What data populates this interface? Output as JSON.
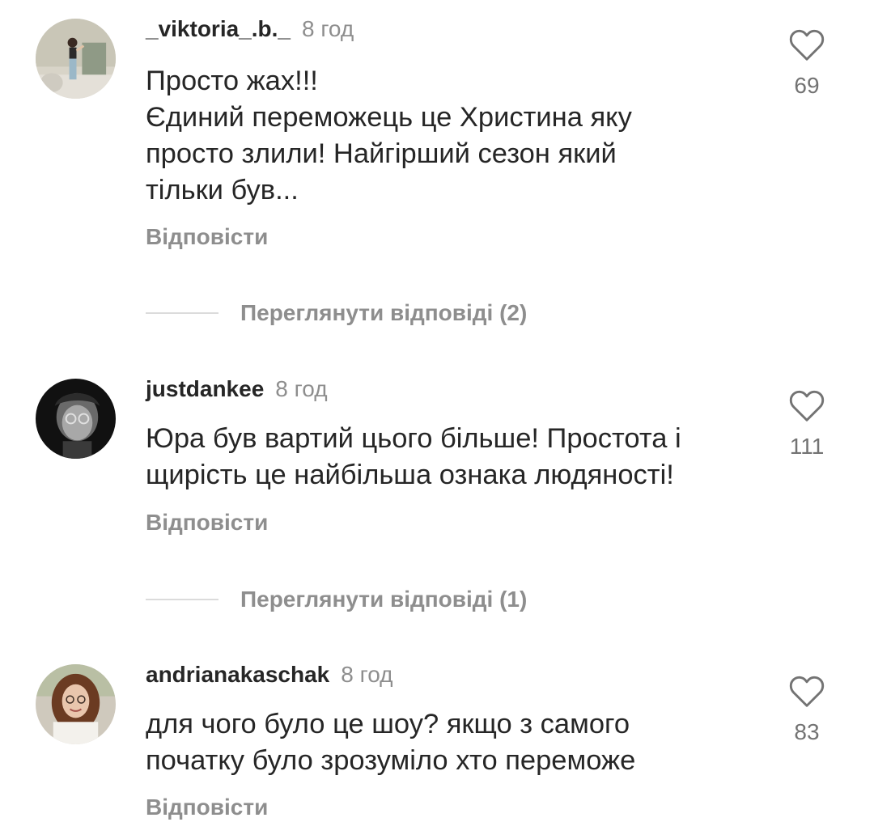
{
  "comments": [
    {
      "username": "_viktoria_.b._",
      "time": "8 год",
      "text_lines": [
        "Просто жах!!!",
        "Єдиний переможець це Христина яку",
        "просто злили! Найгірший сезон який",
        "тільки був..."
      ],
      "reply_label": "Відповісти",
      "likes": "69",
      "view_replies_label": "Переглянути відповіді (2)"
    },
    {
      "username": "justdankee",
      "time": "8 год",
      "text_lines": [
        "Юра був вартий цього більше! Простота і",
        "щирість це найбільша ознака людяності!"
      ],
      "reply_label": "Відповісти",
      "likes": "111",
      "view_replies_label": "Переглянути відповіді (1)"
    },
    {
      "username": "andrianakaschak",
      "time": "8 год",
      "text_lines": [
        "для чого було це шоу? якщо з самого",
        "початку було зрозуміло хто переможе"
      ],
      "reply_label": "Відповісти",
      "likes": "83"
    }
  ],
  "icons": {
    "like": "heart-outline-icon"
  },
  "colors": {
    "text_primary": "#262626",
    "text_secondary": "#8e8e8e",
    "divider": "#dbdbdb"
  }
}
